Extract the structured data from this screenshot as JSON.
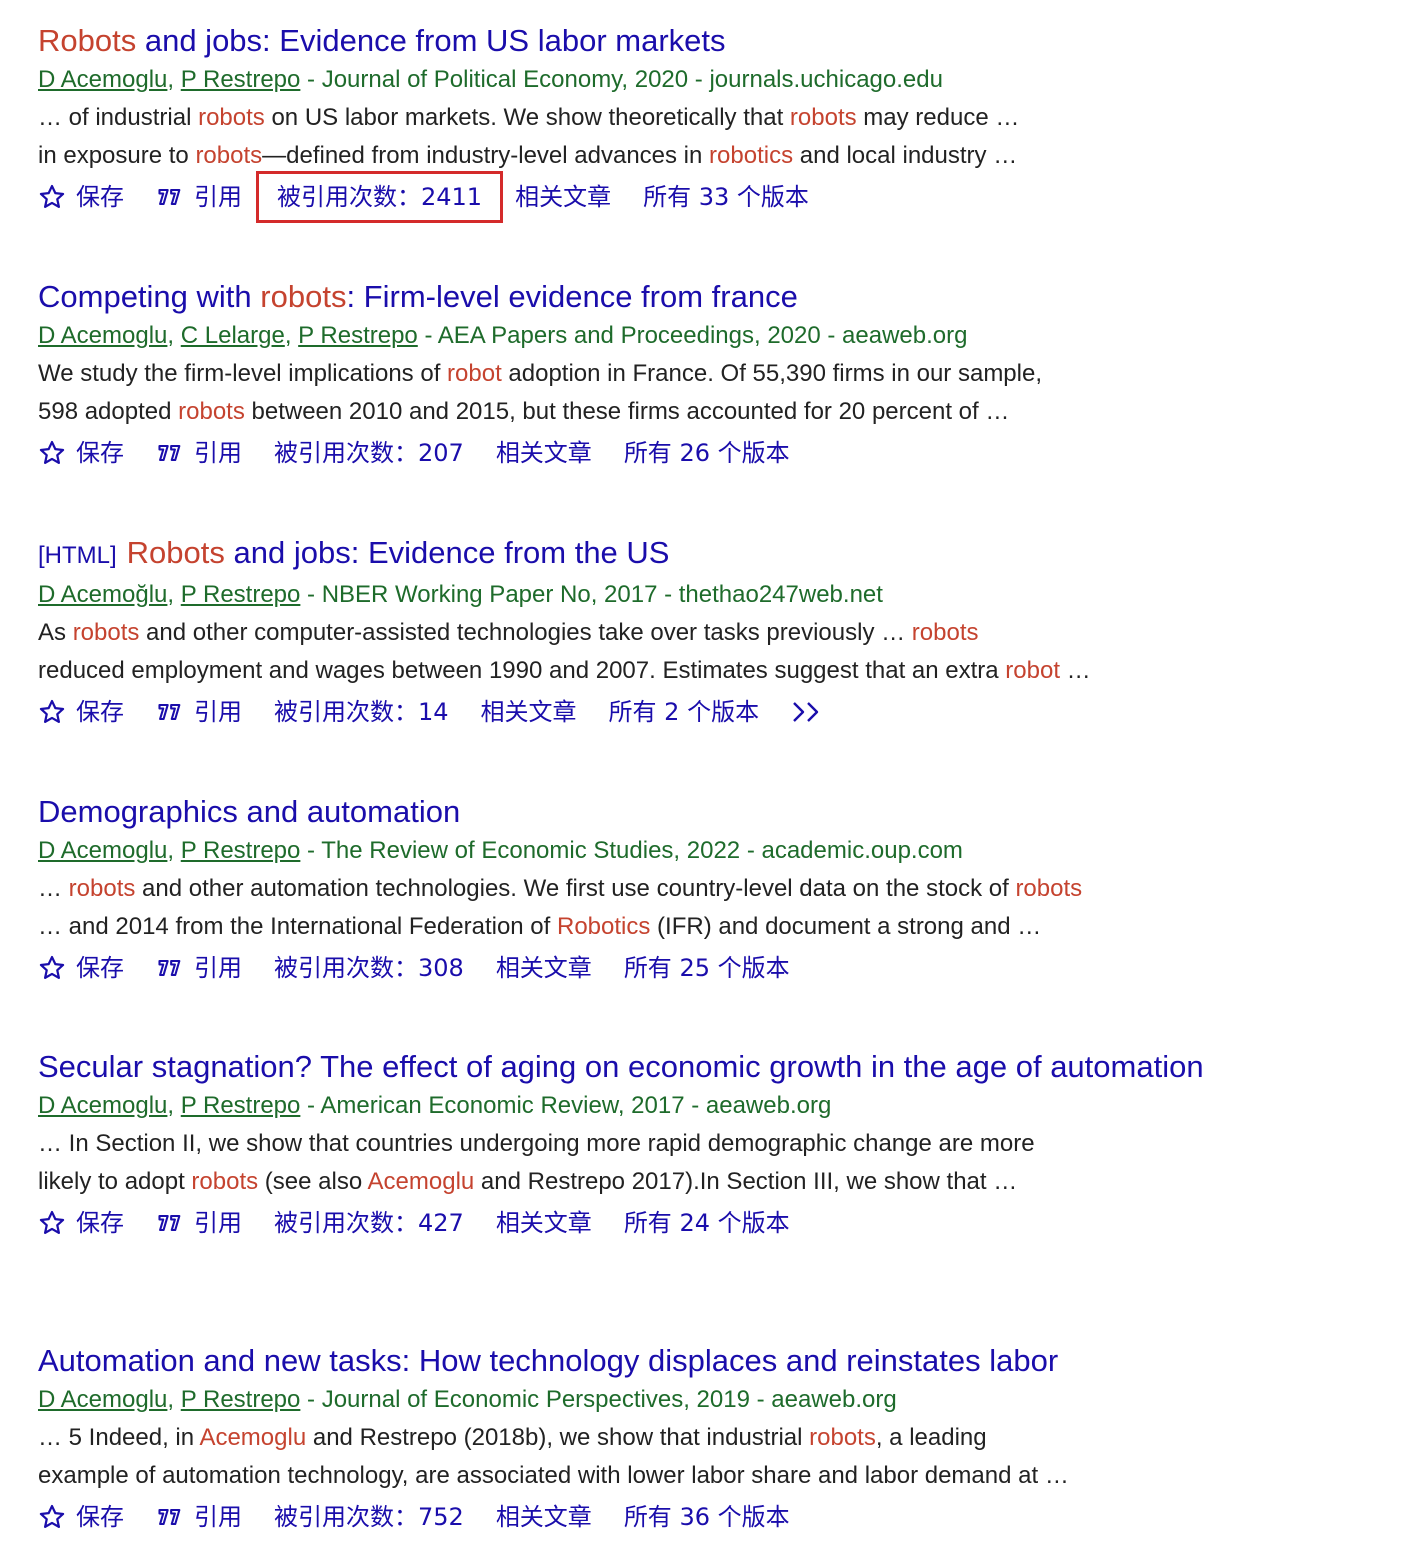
{
  "colors": {
    "title": "#1a0dab",
    "meta": "#1e6b2b",
    "highlight": "#c5432f",
    "snippet": "#222222",
    "annotation_box": "#d42a2a"
  },
  "actions_labels": {
    "save": "保存",
    "cite": "引用",
    "related": "相关文章"
  },
  "icons": {
    "save": "star-outline-icon",
    "cite": "quote-icon",
    "more": "double-chevron-icon"
  },
  "results": [
    {
      "tag": "",
      "title": [
        {
          "text": "Robots",
          "hl": true
        },
        {
          "text": " and jobs: Evidence from US labor markets",
          "hl": false
        }
      ],
      "authors": [
        "D Acemoglu",
        "P Restrepo"
      ],
      "source": " - Journal of Political Economy, 2020 - journals.uchicago.edu",
      "snippet_lines": [
        [
          {
            "text": "… of industrial ",
            "hl": false
          },
          {
            "text": "robots",
            "hl": true
          },
          {
            "text": " on US labor markets. We show theoretically that ",
            "hl": false
          },
          {
            "text": "robots",
            "hl": true
          },
          {
            "text": " may reduce …",
            "hl": false
          }
        ],
        [
          {
            "text": "in exposure to ",
            "hl": false
          },
          {
            "text": "robots",
            "hl": true
          },
          {
            "text": "—defined from industry-level advances in ",
            "hl": false
          },
          {
            "text": "robotics",
            "hl": true
          },
          {
            "text": " and local industry …",
            "hl": false
          }
        ]
      ],
      "cited_by": "被引用次数：2411",
      "versions": "所有 33 个版本",
      "highlighted_citation": true,
      "has_more": false
    },
    {
      "tag": "",
      "title": [
        {
          "text": "Competing with ",
          "hl": false
        },
        {
          "text": "robots",
          "hl": true
        },
        {
          "text": ": Firm-level evidence from france",
          "hl": false
        }
      ],
      "authors": [
        "D Acemoglu",
        "C Lelarge",
        "P Restrepo"
      ],
      "source": " - AEA Papers and Proceedings, 2020 - aeaweb.org",
      "snippet_lines": [
        [
          {
            "text": "We study the firm-level implications of ",
            "hl": false
          },
          {
            "text": "robot",
            "hl": true
          },
          {
            "text": " adoption in France. Of 55,390 firms in our sample,",
            "hl": false
          }
        ],
        [
          {
            "text": "598 adopted ",
            "hl": false
          },
          {
            "text": "robots",
            "hl": true
          },
          {
            "text": " between 2010 and 2015, but these firms accounted for 20 percent of …",
            "hl": false
          }
        ]
      ],
      "cited_by": "被引用次数：207",
      "versions": "所有 26 个版本",
      "highlighted_citation": false,
      "has_more": false
    },
    {
      "tag": "[HTML]",
      "title": [
        {
          "text": "Robots",
          "hl": true
        },
        {
          "text": " and jobs: Evidence from the US",
          "hl": false
        }
      ],
      "authors": [
        "D Acemoğlu",
        "P Restrepo"
      ],
      "source": " - NBER Working Paper No, 2017 - thethao247web.net",
      "snippet_lines": [
        [
          {
            "text": "As ",
            "hl": false
          },
          {
            "text": "robots",
            "hl": true
          },
          {
            "text": " and other computer-assisted technologies take over tasks previously … ",
            "hl": false
          },
          {
            "text": "robots",
            "hl": true
          }
        ],
        [
          {
            "text": "reduced employment and wages between 1990 and 2007. Estimates suggest that an extra ",
            "hl": false
          },
          {
            "text": "robot",
            "hl": true
          },
          {
            "text": " …",
            "hl": false
          }
        ]
      ],
      "cited_by": "被引用次数：14",
      "versions": "所有 2 个版本",
      "highlighted_citation": false,
      "has_more": true
    },
    {
      "tag": "",
      "title": [
        {
          "text": "Demographics and automation",
          "hl": false
        }
      ],
      "authors": [
        "D Acemoglu",
        "P Restrepo"
      ],
      "source": " - The Review of Economic Studies, 2022 - academic.oup.com",
      "snippet_lines": [
        [
          {
            "text": "… ",
            "hl": false
          },
          {
            "text": "robots",
            "hl": true
          },
          {
            "text": " and other automation technologies. We first use country-level data on the stock of ",
            "hl": false
          },
          {
            "text": "robots",
            "hl": true
          }
        ],
        [
          {
            "text": "… and 2014 from the International Federation of ",
            "hl": false
          },
          {
            "text": "Robotics",
            "hl": true
          },
          {
            "text": " (IFR) and document a strong and …",
            "hl": false
          }
        ]
      ],
      "cited_by": "被引用次数：308",
      "versions": "所有 25 个版本",
      "highlighted_citation": false,
      "has_more": false
    },
    {
      "tag": "",
      "title": [
        {
          "text": "Secular stagnation? The effect of aging on economic growth in the age of automation",
          "hl": false
        }
      ],
      "authors": [
        "D Acemoglu",
        "P Restrepo"
      ],
      "source": " - American Economic Review, 2017 - aeaweb.org",
      "snippet_lines": [
        [
          {
            "text": "… In Section II, we show that countries undergoing more rapid demographic change are more",
            "hl": false
          }
        ],
        [
          {
            "text": "likely to adopt ",
            "hl": false
          },
          {
            "text": "robots",
            "hl": true
          },
          {
            "text": " (see also ",
            "hl": false
          },
          {
            "text": "Acemoglu",
            "hl": true
          },
          {
            "text": " and Restrepo 2017).In Section III, we show that …",
            "hl": false
          }
        ]
      ],
      "cited_by": "被引用次数：427",
      "versions": "所有 24 个版本",
      "highlighted_citation": false,
      "has_more": false
    },
    {
      "tag": "",
      "title": [
        {
          "text": "Automation and new tasks: How technology displaces and reinstates labor",
          "hl": false
        }
      ],
      "authors": [
        "D Acemoglu",
        "P Restrepo"
      ],
      "source": " - Journal of Economic Perspectives, 2019 - aeaweb.org",
      "snippet_lines": [
        [
          {
            "text": "… 5 Indeed, in ",
            "hl": false
          },
          {
            "text": "Acemoglu",
            "hl": true
          },
          {
            "text": " and Restrepo (2018b), we show that industrial ",
            "hl": false
          },
          {
            "text": "robots",
            "hl": true
          },
          {
            "text": ", a leading",
            "hl": false
          }
        ],
        [
          {
            "text": "example of automation technology, are associated with lower labor share and labor demand at …",
            "hl": false
          }
        ]
      ],
      "cited_by": "被引用次数：752",
      "versions": "所有 36 个版本",
      "highlighted_citation": false,
      "has_more": false
    }
  ]
}
